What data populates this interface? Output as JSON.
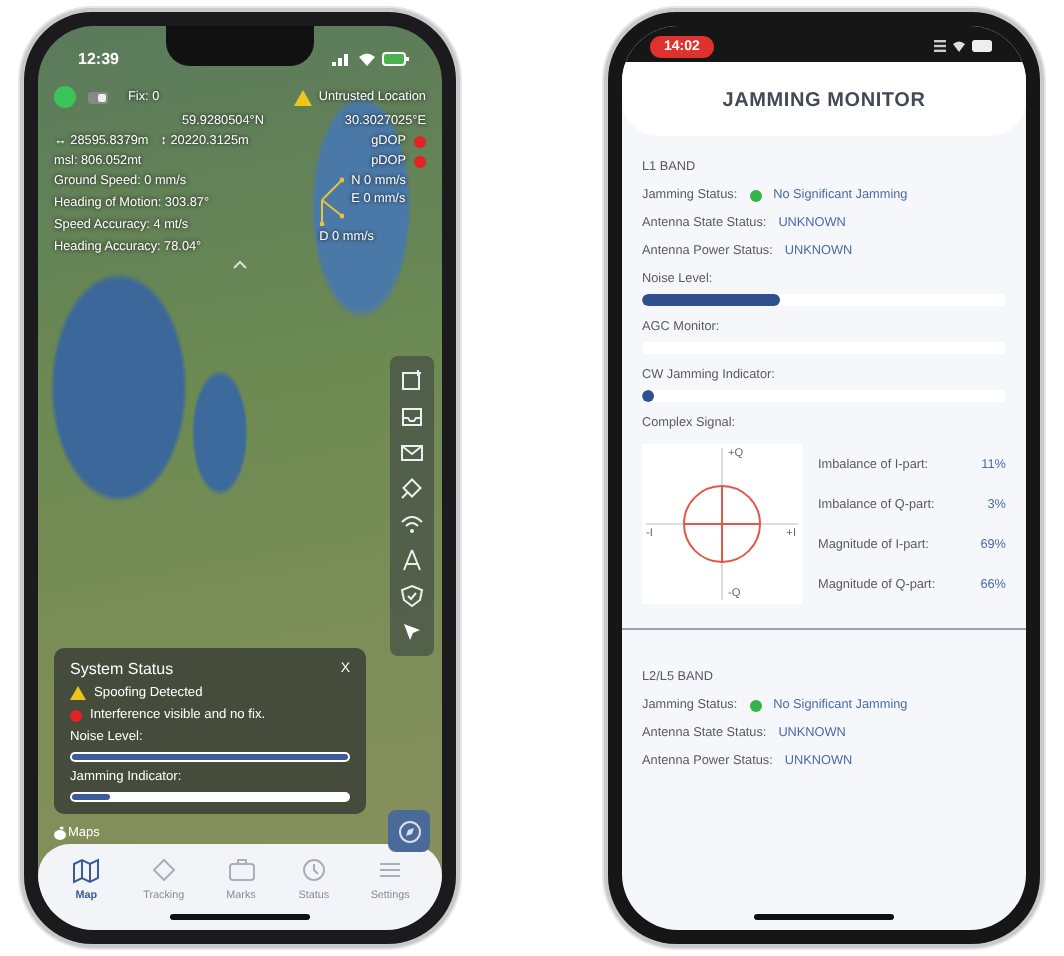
{
  "map_phone": {
    "status_bar": {
      "time": "12:39"
    },
    "info": {
      "fix": "Fix: 0",
      "warning": "Untrusted Location",
      "latitude": "59.9280504°N",
      "longitude": "30.3027025°E",
      "x_offset": "↔ 28595.8379m",
      "y_offset": "↕ 20220.3125m",
      "msl": "msl: 806.052mt",
      "dop": [
        {
          "label": "gDOP"
        },
        {
          "label": "pDOP"
        }
      ],
      "stats": [
        "Ground Speed: 0 mm/s",
        "Heading of Motion: 303.87°",
        "Speed Accuracy: 4 mt/s",
        "Heading Accuracy: 78.04°"
      ],
      "velocity": [
        "N 0 mm/s",
        "E 0 mm/s",
        "D 0 mm/s"
      ]
    },
    "system_status": {
      "title": "System Status",
      "close": "X",
      "alerts": [
        {
          "kind": "warning",
          "text": "Spoofing Detected"
        },
        {
          "kind": "error",
          "text": "Interference visible and no fix."
        }
      ],
      "meters": [
        {
          "label": "Noise Level:",
          "level": 1.0
        },
        {
          "label": "Jamming Indicator:",
          "level": 0.14
        }
      ]
    },
    "map_credit": "Maps",
    "tabs": [
      {
        "label": "Map",
        "selected": true
      },
      {
        "label": "Tracking",
        "selected": false
      },
      {
        "label": "Marks",
        "selected": false
      },
      {
        "label": "Status",
        "selected": false
      },
      {
        "label": "Settings",
        "selected": false
      }
    ]
  },
  "monitor_phone": {
    "status_bar": {
      "time": "14:02"
    },
    "title": "JAMMING MONITOR",
    "bands": [
      {
        "name": "L1 BAND",
        "jamming_label": "Jamming Status:",
        "jamming_value": "No Significant Jamming",
        "fields": [
          {
            "label": "Antenna State Status:",
            "value": "UNKNOWN"
          },
          {
            "label": "Antenna Power Status:",
            "value": "UNKNOWN"
          }
        ],
        "meters": [
          {
            "label": "Noise Level:",
            "level": 0.38
          },
          {
            "label": "AGC Monitor:"
          },
          {
            "label": "CW Jamming Indicator:",
            "level": 0.03
          }
        ],
        "complex_signal": {
          "title": "Complex Signal:",
          "axes": {
            "top": "+Q",
            "left": "-I",
            "right": "+I",
            "bottom": "-Q"
          },
          "metrics": [
            {
              "label": "Imbalance of I-part:",
              "value": "11%"
            },
            {
              "label": "Imbalance of Q-part:",
              "value": "3%"
            },
            {
              "label": "Magnitude of I-part:",
              "value": "69%"
            },
            {
              "label": "Magnitude of Q-part:",
              "value": "66%"
            }
          ]
        }
      },
      {
        "name": "L2/L5 BAND",
        "jamming_label": "Jamming Status:",
        "jamming_value": "No Significant Jamming",
        "fields": [
          {
            "label": "Antenna State Status:",
            "value": "UNKNOWN"
          },
          {
            "label": "Antenna Power Status:",
            "value": "UNKNOWN"
          }
        ]
      }
    ]
  }
}
